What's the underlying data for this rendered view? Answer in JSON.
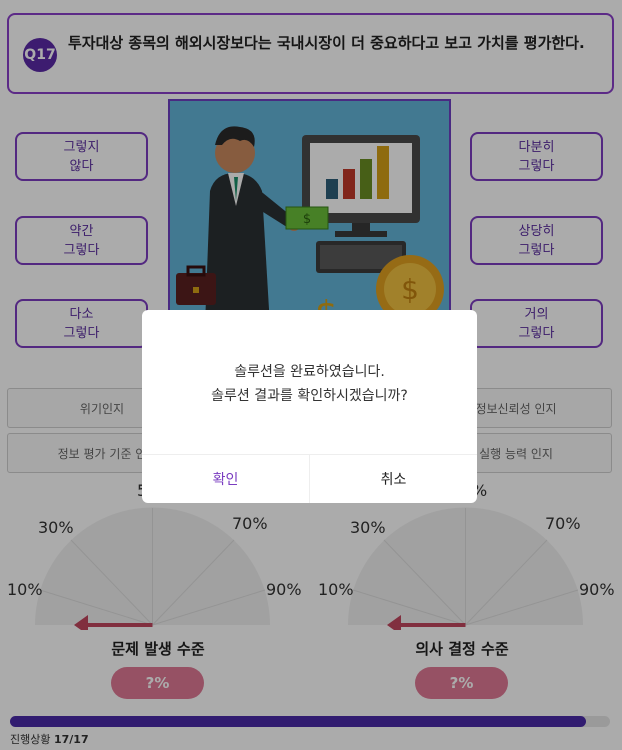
{
  "question": {
    "badge": "Q17",
    "text": "투자대상 종목의 해외시장보다는 국내시장이 더 중요하다고 보고 가치를 평가한다."
  },
  "options": {
    "left": [
      "그렇지\n않다",
      "약간\n그렇다",
      "다소\n그렇다"
    ],
    "right": [
      "다분히\n그렇다",
      "상당히\n그렇다",
      "거의\n그렇다"
    ]
  },
  "categories": {
    "row1_left": "위기인지",
    "row1_right": "정보신뢰성 인지",
    "row2_left": "정보 평가 기준 인",
    "row2_right": "실행 능력 인지"
  },
  "gauges": [
    {
      "title": "문제 발생 수준",
      "value_label": "?%",
      "top_label": "5",
      "ticks": {
        "t10": "10%",
        "t30": "30%",
        "t70": "70%",
        "t90": "90%"
      }
    },
    {
      "title": "의사 결정 수준",
      "value_label": "?%",
      "top_label": "%",
      "ticks": {
        "t10": "10%",
        "t30": "30%",
        "t70": "70%",
        "t90": "90%"
      }
    }
  ],
  "progress": {
    "label": "진행상황",
    "count": "17/17",
    "fraction": 0.96
  },
  "dialog": {
    "message_line1": "솔루션을 완료하였습니다.",
    "message_line2": "솔루션 결과를 확인하시겠습니까?",
    "confirm": "확인",
    "cancel": "취소"
  },
  "colors": {
    "accent": "#7c3cc0",
    "badge": "#5b2aa8",
    "pill": "#e07a95",
    "progress": "#4a2aa8"
  }
}
